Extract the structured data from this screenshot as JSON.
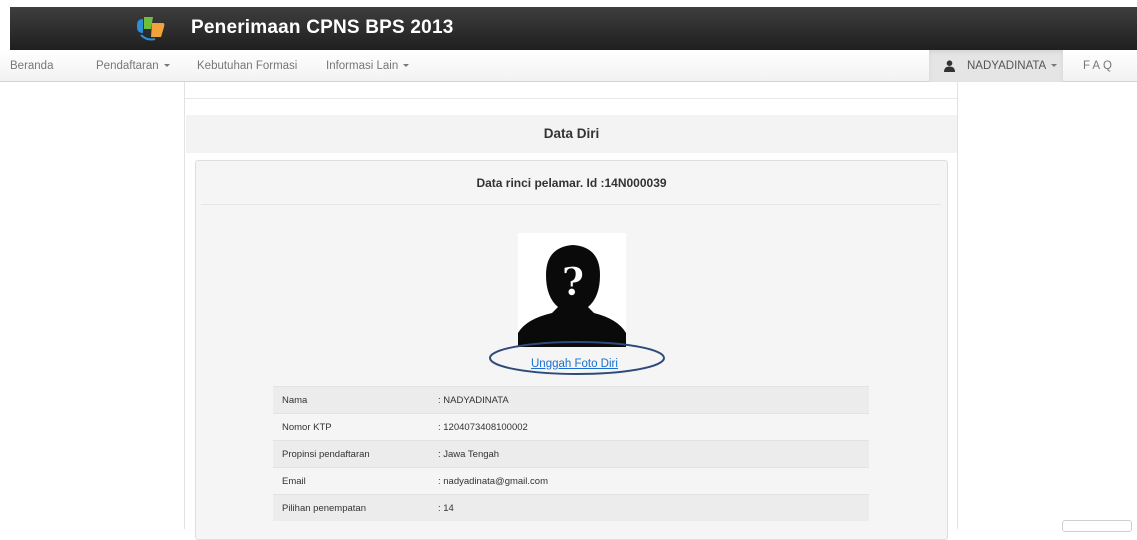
{
  "header": {
    "title": "Penerimaan CPNS BPS 2013",
    "logo_icon": "bps-logo-icon"
  },
  "nav": {
    "items": [
      {
        "label": "Beranda",
        "dropdown": false
      },
      {
        "label": "Pendaftaran",
        "dropdown": true
      },
      {
        "label": "Kebutuhan Formasi",
        "dropdown": false
      },
      {
        "label": "Informasi Lain",
        "dropdown": true
      }
    ],
    "user": {
      "label": "NADYADINATA",
      "icon": "user-icon"
    },
    "faq": "FAQ"
  },
  "section": {
    "title": "Data Diri"
  },
  "panel": {
    "title": "Data rinci pelamar. Id :14N000039",
    "photo_icon": "unknown-person-icon",
    "upload_link": "Unggah Foto Diri"
  },
  "details": [
    {
      "label": "Nama",
      "value": ": NADYADINATA"
    },
    {
      "label": "Nomor KTP",
      "value": ": 1204073408100002"
    },
    {
      "label": "Propinsi pendaftaran",
      "value": ": Jawa Tengah"
    },
    {
      "label": "Email",
      "value": ": nadyadinata@gmail.com"
    },
    {
      "label": "Pilihan penempatan",
      "value": ": 14"
    }
  ],
  "colors": {
    "topbar": "#2b2b2b",
    "link": "#1a6fd0",
    "highlight_oval": "#2e4a78"
  }
}
